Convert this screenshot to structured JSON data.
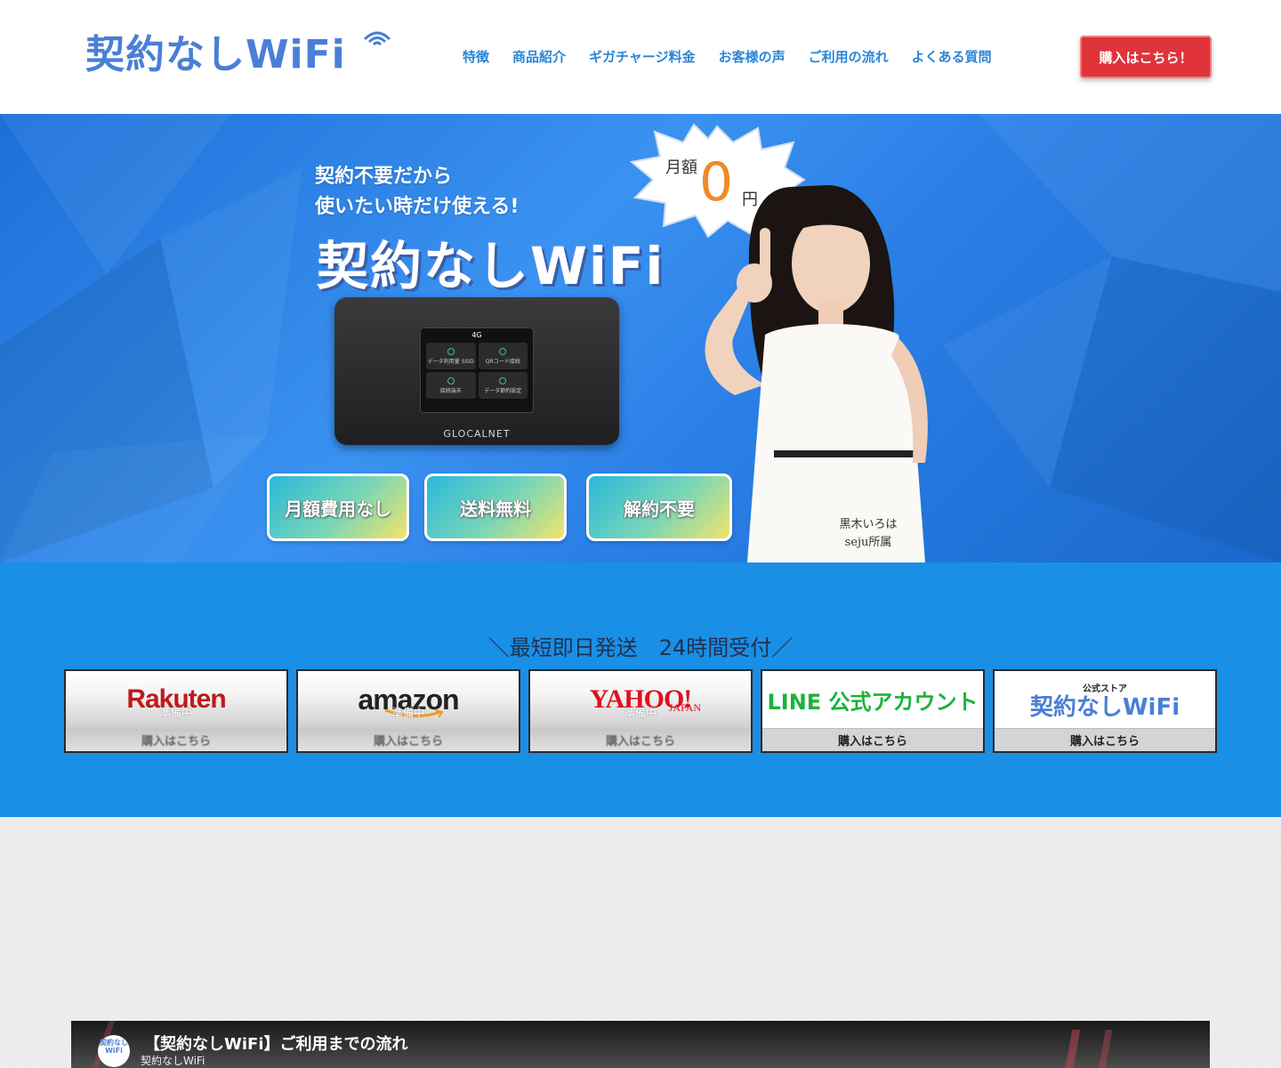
{
  "header": {
    "logo_text": "契約なしWiFi",
    "nav": [
      "特徴",
      "商品紹介",
      "ギガチャージ料金",
      "お客様の声",
      "ご利用の流れ",
      "よくある質問"
    ],
    "buy_label": "購入はこちら！"
  },
  "hero": {
    "copy_line1": "契約不要だから",
    "copy_line2": "使いたい時だけ使える!",
    "title": "契約なしWiFi",
    "burst_label": "月額",
    "burst_number": "0",
    "burst_unit": "円",
    "device": {
      "status": "4G",
      "tiles": [
        "データ利用量 SSID",
        "QRコード接続",
        "接続端末",
        "データ節約設定"
      ],
      "brand": "GLOCALNET"
    },
    "features": [
      "月額費用なし",
      "送料無料",
      "解約不要"
    ],
    "caption_line1": "黒木いろは",
    "caption_line2": "seju所属"
  },
  "shipping": {
    "title": "＼最短即日発送　24時間受付／",
    "stores": [
      {
        "name": "Rakuten",
        "status": "準備中",
        "button": "購入はこちら"
      },
      {
        "name": "amazon",
        "status": "準備中",
        "button": "購入はこちら"
      },
      {
        "name": "YAHOO!",
        "sub": "JAPAN",
        "status": "準備中",
        "button": "購入はこちら"
      },
      {
        "name": "LINE 公式アカウント",
        "button": "購入はこちら"
      },
      {
        "name": "契約なしWiFi",
        "sub": "公式ストア",
        "button": "購入はこちら"
      }
    ]
  },
  "video": {
    "channel_icon": "契約なしWiFi",
    "title": "【契約なしWiFi】ご利用までの流れ",
    "channel": "契約なしWiFi"
  },
  "colors": {
    "brand_blue": "#4a7fd6",
    "nav_blue": "#2a86d6",
    "buy_red": "#e0333a",
    "band_blue": "#1a8fe6",
    "zero_orange": "#f08a28"
  }
}
